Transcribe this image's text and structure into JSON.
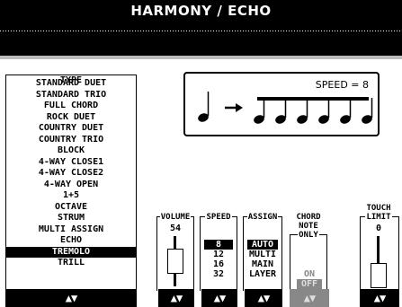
{
  "title": "HARMONY / ECHO",
  "type_panel": {
    "caption": "TYPE",
    "items": [
      "STANDARD DUET",
      "STANDARD TRIO",
      "FULL CHORD",
      "ROCK DUET",
      "COUNTRY DUET",
      "COUNTRY TRIO",
      "BLOCK",
      "4-WAY CLOSE1",
      "4-WAY CLOSE2",
      "4-WAY OPEN",
      "1+5",
      "OCTAVE",
      "STRUM",
      "MULTI ASSIGN",
      "ECHO",
      "TREMOLO",
      "TRILL"
    ],
    "selected": "TREMOLO"
  },
  "speed_display": {
    "label": "SPEED = 8"
  },
  "volume": {
    "label": "VOLUME",
    "value": "54",
    "level": 0.54
  },
  "speed": {
    "label": "SPEED",
    "options": [
      "8",
      "12",
      "16",
      "32"
    ],
    "selected": "8"
  },
  "assign": {
    "label": "ASSIGN",
    "options": [
      "AUTO",
      "MULTI",
      "MAIN",
      "LAYER"
    ],
    "selected": "AUTO"
  },
  "chord_note_only": {
    "label_1": "CHORD",
    "label_2": "NOTE",
    "label_3": "ONLY",
    "on": "ON",
    "off": "OFF",
    "enabled": false
  },
  "touch_limit": {
    "label_1": "TOUCH",
    "label_2": "LIMIT",
    "value": "0",
    "level": 0.0
  },
  "arrow_glyph": "▲▼",
  "colors": {
    "background": "#ffffff",
    "ink": "#000000",
    "disabled": "#888888"
  }
}
